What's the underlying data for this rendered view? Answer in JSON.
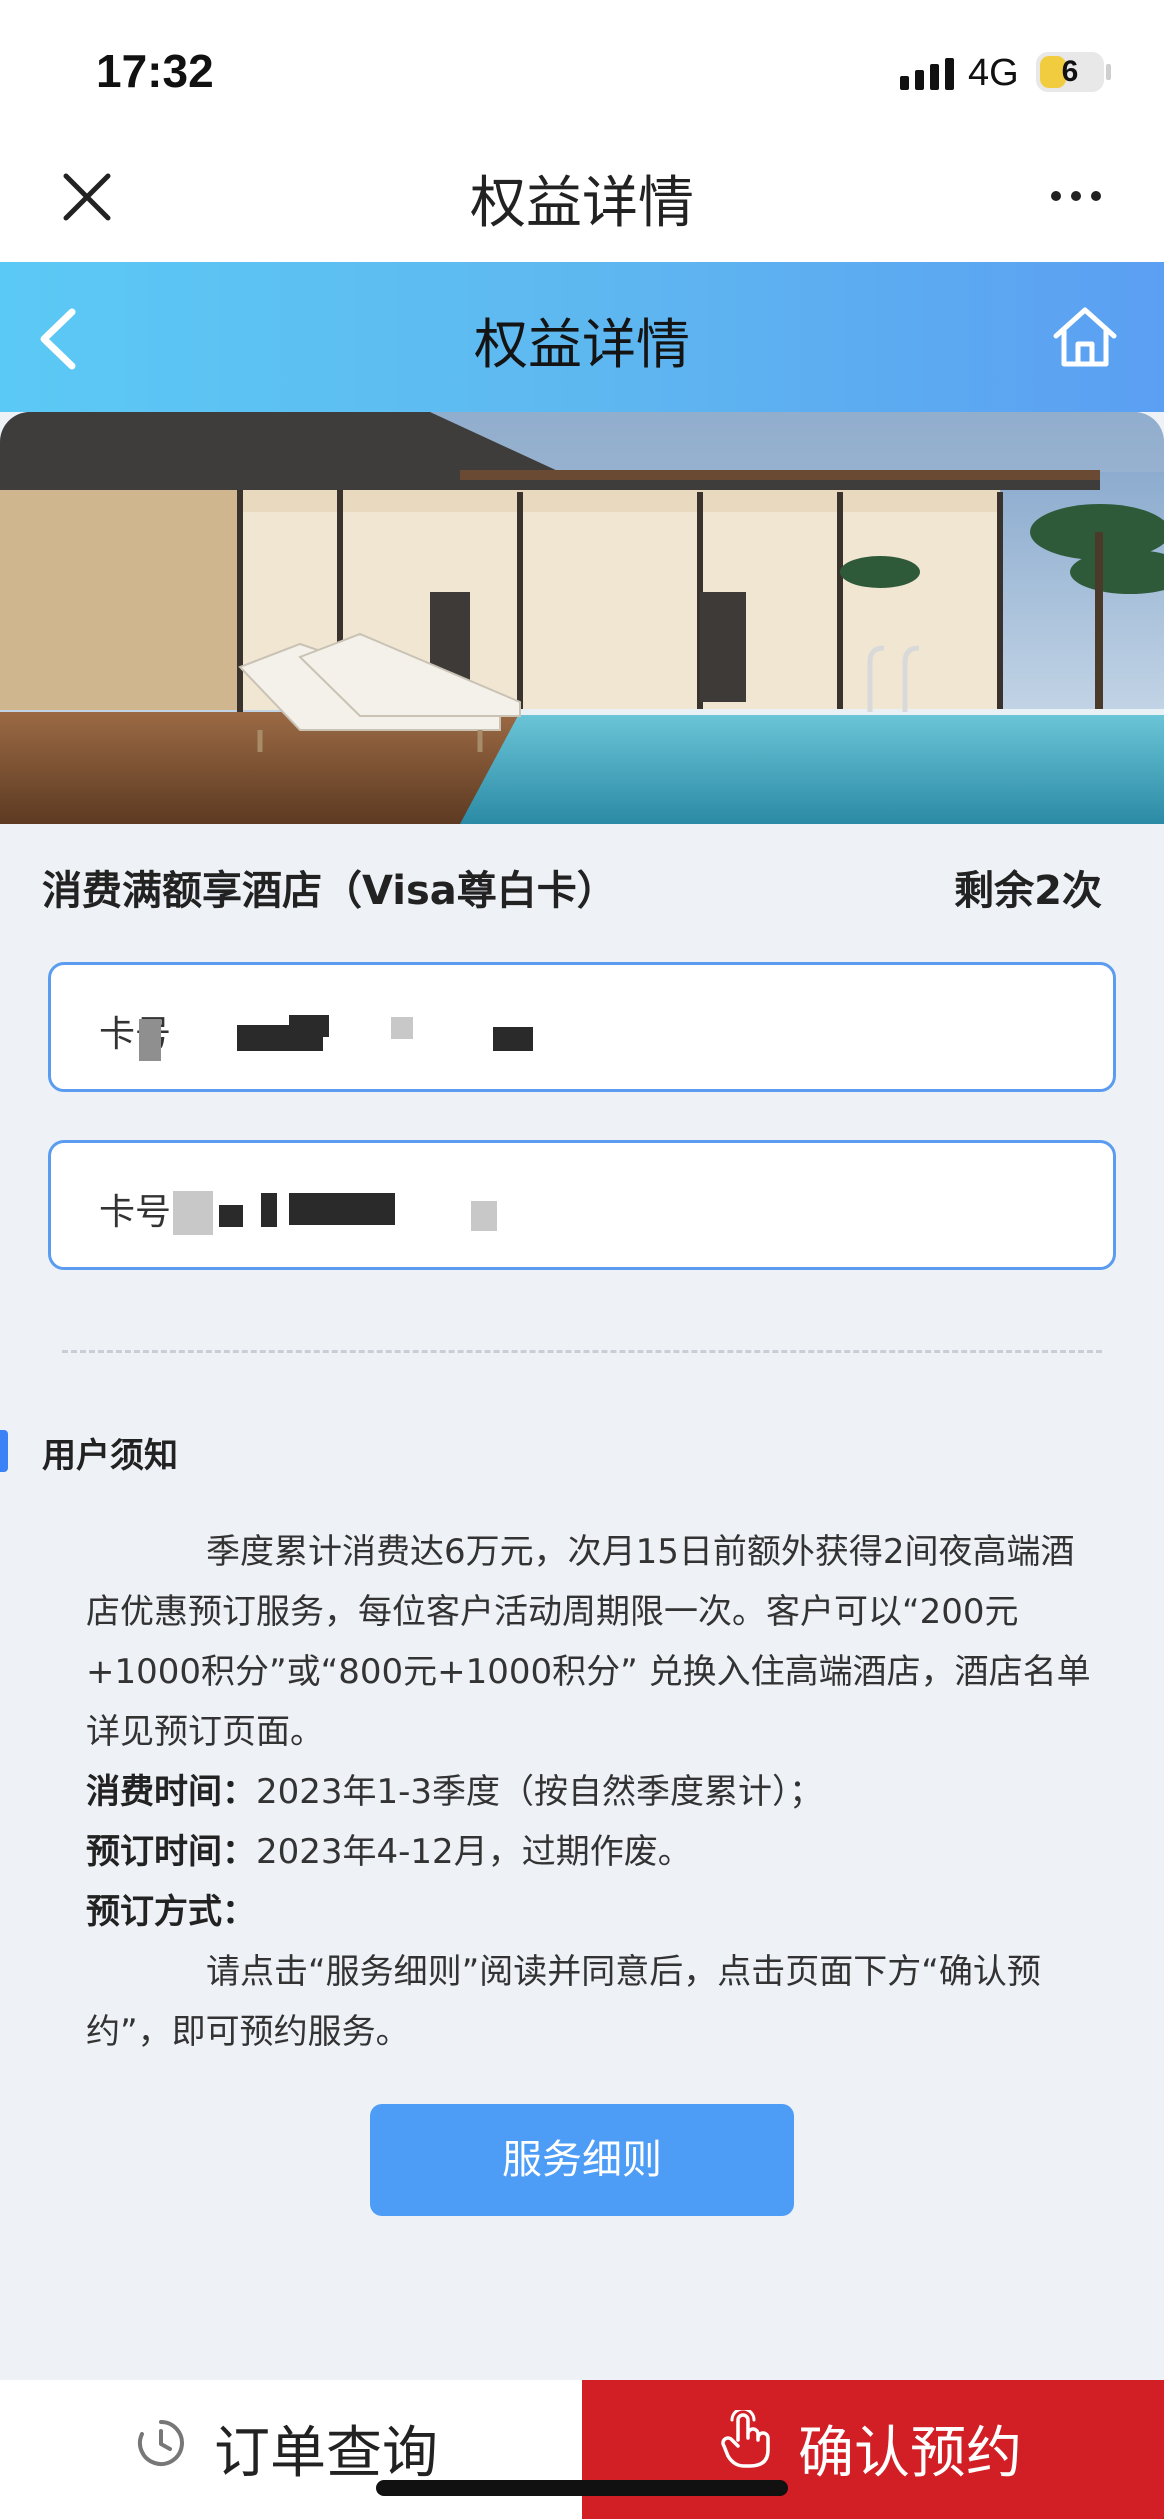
{
  "status_bar": {
    "time": "17:32",
    "network": "4G",
    "battery": "6"
  },
  "webview": {
    "title": "权益详情"
  },
  "header": {
    "title": "权益详情"
  },
  "benefit": {
    "title": "消费满额享酒店（Visa尊白卡）",
    "remaining": "剩余2次"
  },
  "cards": [
    {
      "label": "卡号"
    },
    {
      "label": "卡号"
    }
  ],
  "notice": {
    "title": "用户须知",
    "paragraph1": "季度累计消费达6万元，次月15日前额外获得2间夜高端酒店优惠预订服务，每位客户活动周期限一次。客户可以“200元+1000积分”或“800元+1000积分” 兑换入住高端酒店，酒店名单详见预订页面。",
    "spend_time_label": "消费时间：",
    "spend_time_value": "2023年1-3季度（按自然季度累计）；",
    "booking_time_label": "预订时间：",
    "booking_time_value": "2023年4-12月，过期作废。",
    "booking_method_label": "预订方式：",
    "paragraph2": "请点击“服务细则”阅读并同意后，点击页面下方“确认预约”，即可预约服务。"
  },
  "buttons": {
    "rules": "服务细则",
    "order_query": "订单查询",
    "confirm": "确认预约"
  },
  "colors": {
    "accent": "#4d9cf5",
    "confirm_bg": "#d21f25",
    "header_gradient_start": "#5bc9f5",
    "header_gradient_end": "#5b9ff2"
  }
}
